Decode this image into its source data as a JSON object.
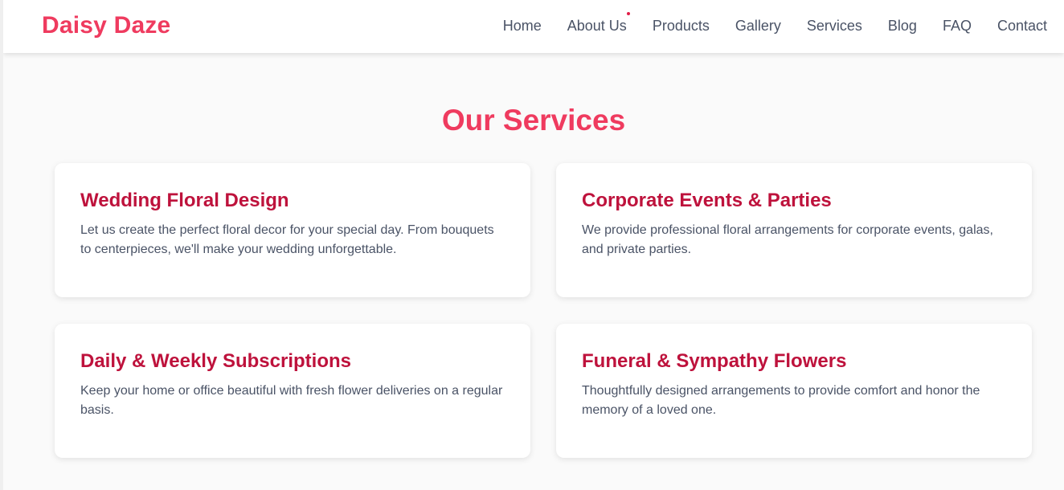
{
  "brand": {
    "name": "Daisy Daze"
  },
  "nav": {
    "items": [
      {
        "label": "Home"
      },
      {
        "label": "About Us"
      },
      {
        "label": "Products"
      },
      {
        "label": "Gallery"
      },
      {
        "label": "Services"
      },
      {
        "label": "Blog"
      },
      {
        "label": "FAQ"
      },
      {
        "label": "Contact"
      }
    ]
  },
  "services": {
    "title": "Our Services",
    "cards": [
      {
        "title": "Wedding Floral Design",
        "text": "Let us create the perfect floral decor for your special day. From bouquets to centerpieces, we'll make your wedding unforgettable."
      },
      {
        "title": "Corporate Events & Parties",
        "text": "We provide professional floral arrangements for corporate events, galas, and private parties."
      },
      {
        "title": "Daily & Weekly Subscriptions",
        "text": "Keep your home or office beautiful with fresh flower deliveries on a regular basis."
      },
      {
        "title": "Funeral & Sympathy Flowers",
        "text": "Thoughtfully designed arrangements to provide comfort and honor the memory of a loved one."
      }
    ]
  },
  "colors": {
    "brand": "#ef3b5f",
    "card_title": "#be123c",
    "text": "#4a5366",
    "background": "#fafafa"
  }
}
